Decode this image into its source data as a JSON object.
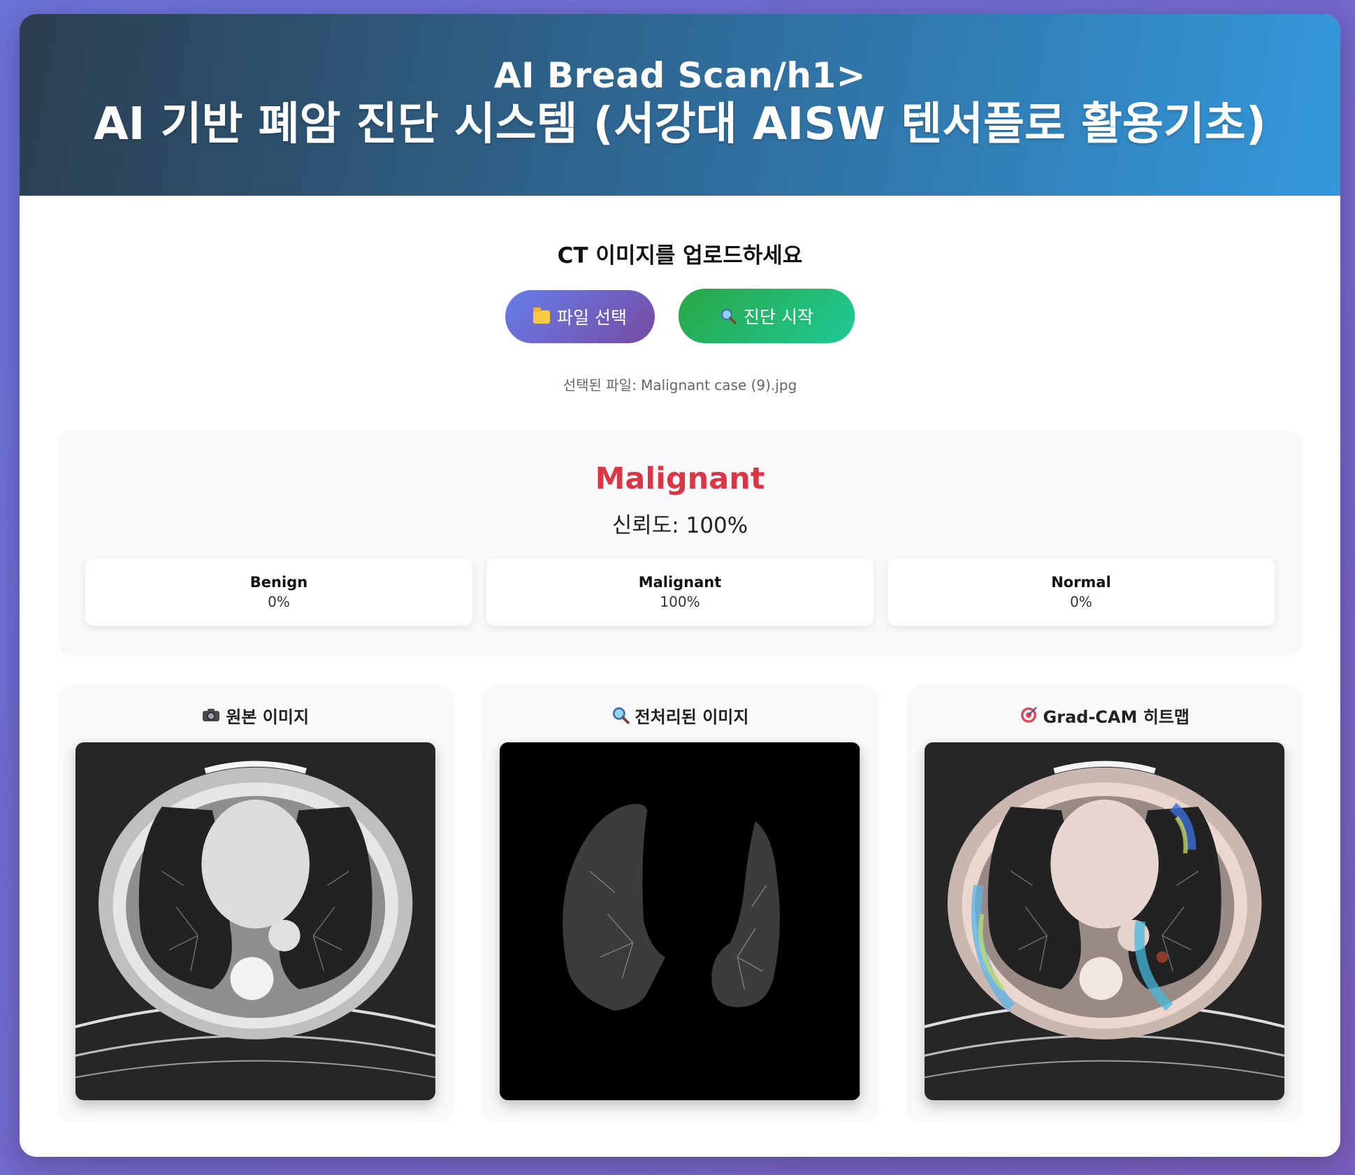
{
  "header": {
    "title_line1": "AI Bread Scan/h1>",
    "title_line2": "AI 기반 폐암 진단 시스템 (서강대 AISW 텐서플로 활용기초)"
  },
  "upload": {
    "heading": "CT 이미지를 업로드하세요",
    "file_button": "파일 선택",
    "file_button_icon": "folder-icon",
    "diagnose_button": "진단 시작",
    "diagnose_button_icon": "magnifier-icon",
    "selected_file": "선택된 파일: Malignant case (9).jpg"
  },
  "result": {
    "prediction": "Malignant",
    "confidence": "신뢰도: 100%",
    "probabilities": [
      {
        "label": "Benign",
        "value": "0%"
      },
      {
        "label": "Malignant",
        "value": "100%"
      },
      {
        "label": "Normal",
        "value": "0%"
      }
    ]
  },
  "images": [
    {
      "title": "원본 이미지",
      "icon": "camera-icon"
    },
    {
      "title": "전처리된 이미지",
      "icon": "magnifier-icon"
    },
    {
      "title": "Grad-CAM 히트맵",
      "icon": "target-icon"
    }
  ],
  "colors": {
    "prediction": "#dc3545",
    "file_button": "#667eea",
    "diagnose_button": "#28a745"
  }
}
